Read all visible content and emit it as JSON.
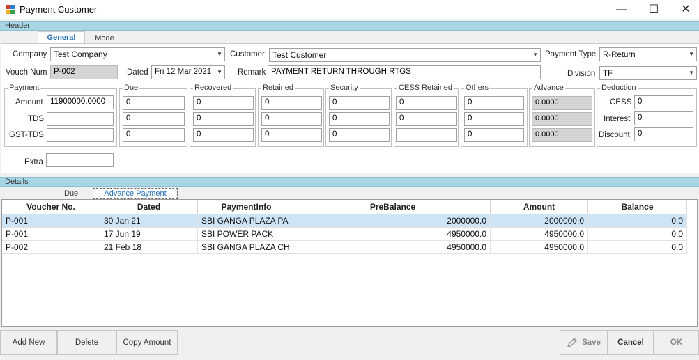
{
  "window": {
    "title": "Payment Customer",
    "minimize": "—",
    "maximize": "☐",
    "close": "✕"
  },
  "header": {
    "section_label": "Header",
    "tabs": [
      "General",
      "Mode"
    ],
    "company_label": "Company",
    "company_value": "Test Company",
    "customer_label": "Customer",
    "customer_value": "Test Customer",
    "payment_type_label": "Payment Type",
    "payment_type_value": "R-Return",
    "vouch_num_label": "Vouch Num",
    "vouch_num_value": "P-002",
    "dated_label": "Dated",
    "dated_value": "Fri 12 Mar 2021",
    "remark_label": "Remark",
    "remark_value": "PAYMENT RETURN THROUGH RTGS",
    "division_label": "Division",
    "division_value": "TF"
  },
  "payment": {
    "group_title": "Payment",
    "amount_label": "Amount",
    "amount_value": "11900000.0000",
    "tds_label": "TDS",
    "tds_value": "",
    "gst_tds_label": "GST-TDS",
    "gst_tds_value": "",
    "extra_label": "Extra",
    "extra_value": ""
  },
  "groups": {
    "due": {
      "title": "Due",
      "values": [
        "0",
        "0",
        "0"
      ]
    },
    "recovered": {
      "title": "Recovered",
      "values": [
        "0",
        "0",
        "0"
      ]
    },
    "retained": {
      "title": "Retained",
      "values": [
        "0",
        "0",
        "0"
      ]
    },
    "security": {
      "title": "Security",
      "values": [
        "0",
        "0",
        "0"
      ]
    },
    "cess_retained": {
      "title": "CESS Retained",
      "values": [
        "0",
        "0",
        ""
      ]
    },
    "others": {
      "title": "Others",
      "values": [
        "0",
        "0",
        "0"
      ]
    },
    "advance": {
      "title": "Advance",
      "values": [
        "0.0000",
        "0.0000",
        "0.0000"
      ]
    }
  },
  "deduction": {
    "group_title": "Deduction",
    "cess_label": "CESS",
    "cess_value": "0",
    "interest_label": "Interest",
    "interest_value": "0",
    "discount_label": "Discount",
    "discount_value": "0"
  },
  "details": {
    "section_label": "Details",
    "tabs": [
      "Due",
      "Advance Payment"
    ],
    "columns": [
      "Voucher No.",
      "Dated",
      "PaymentInfo",
      "PreBalance",
      "Amount",
      "Balance"
    ],
    "rows": [
      [
        "P-001",
        "30 Jan 21",
        "SBI  GANGA PLAZA PA",
        "2000000.0",
        "2000000.0",
        "0.0"
      ],
      [
        "P-001",
        "17 Jun 19",
        "SBI POWER PACK",
        "4950000.0",
        "4950000.0",
        "0.0"
      ],
      [
        "P-002",
        "21 Feb 18",
        "SBI  GANGA PLAZA CH",
        "4950000.0",
        "4950000.0",
        "0.0"
      ]
    ]
  },
  "buttons": {
    "add_new": "Add New",
    "delete": "Delete",
    "copy_amount": "Copy Amount",
    "save": "Save",
    "cancel": "Cancel",
    "ok": "OK"
  },
  "colors": {
    "section_bar": "#a9d6e5",
    "selected_row": "#cde4f7",
    "tab_active_text": "#2470b4"
  }
}
